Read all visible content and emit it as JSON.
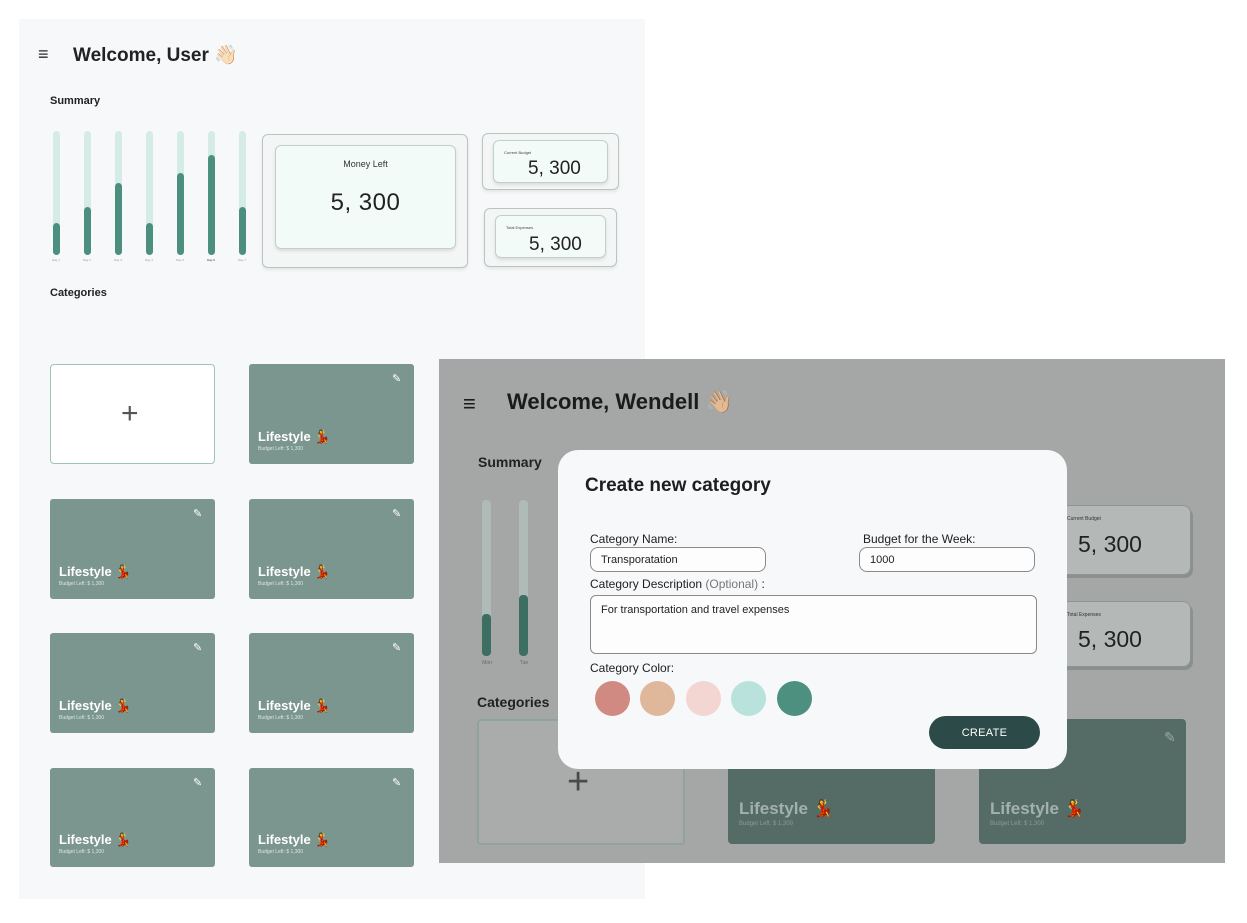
{
  "screen1": {
    "welcome": "Welcome, User 👋🏻",
    "summary_title": "Summary",
    "chart": {
      "days": [
        "Day 1",
        "Day 2",
        "Day 3",
        "Day 4",
        "Day 5",
        "Day 6",
        "Day 7"
      ],
      "fill_fraction": [
        0.26,
        0.39,
        0.58,
        0.26,
        0.66,
        0.81,
        0.39
      ],
      "active_day": "Day 6"
    },
    "money_left": {
      "label": "Money Left",
      "value": "5, 300"
    },
    "current_budget": {
      "label": "Current Budget",
      "value": "5, 300"
    },
    "total_expenses": {
      "label": "Total Expenses",
      "value": "5, 300"
    },
    "categories_title": "Categories",
    "add_symbol": "+",
    "categories": [
      {
        "name": "Lifestyle 💃",
        "budget": "Budget Left: $ 1,300"
      },
      {
        "name": "Lifestyle 💃",
        "budget": "Budget Left: $ 1,300"
      },
      {
        "name": "Lifestyle 💃",
        "budget": "Budget Left: $ 1,300"
      },
      {
        "name": "Lifestyle 💃",
        "budget": "Budget Left: $ 1,300"
      },
      {
        "name": "Lifestyle 💃",
        "budget": "Budget Left: $ 1,300"
      },
      {
        "name": "Lifestyle 💃",
        "budget": "Budget Left: $ 1,300"
      },
      {
        "name": "Lifestyle 💃",
        "budget": "Budget Left: $ 1,300"
      }
    ]
  },
  "screen2": {
    "welcome": "Welcome, Wendell 👋🏼",
    "summary_title": "Summary",
    "chart": {
      "days": [
        "Mon",
        "Tue"
      ],
      "fill_fraction": [
        0.27,
        0.39
      ]
    },
    "current_budget": {
      "label": "Current Budget",
      "value": "5, 300"
    },
    "total_expenses": {
      "label": "Total Expenses",
      "value": "5, 300"
    },
    "categories_title": "Categories",
    "add_symbol": "+",
    "categories": [
      {
        "name": "Lifestyle 💃",
        "budget": "Budget Left: $ 1,300"
      },
      {
        "name": "Lifestyle 💃",
        "budget": "Budget Left: $ 1,300"
      }
    ]
  },
  "modal": {
    "title": "Create new category",
    "name_label": "Category Name:",
    "name_value": "Transporatation",
    "budget_label": "Budget for the Week:",
    "budget_value": "1000",
    "desc_label": "Category Description",
    "desc_optional": "(Optional)",
    "desc_colon": ":",
    "desc_value": "For transportation and travel expenses",
    "color_label": "Category Color:",
    "colors": [
      "#d08a82",
      "#dfb89b",
      "#f3d6d1",
      "#b9e2dc",
      "#4d907f"
    ],
    "create_label": "CREATE"
  },
  "icons": {
    "menu": "≡",
    "edit": "✎"
  }
}
